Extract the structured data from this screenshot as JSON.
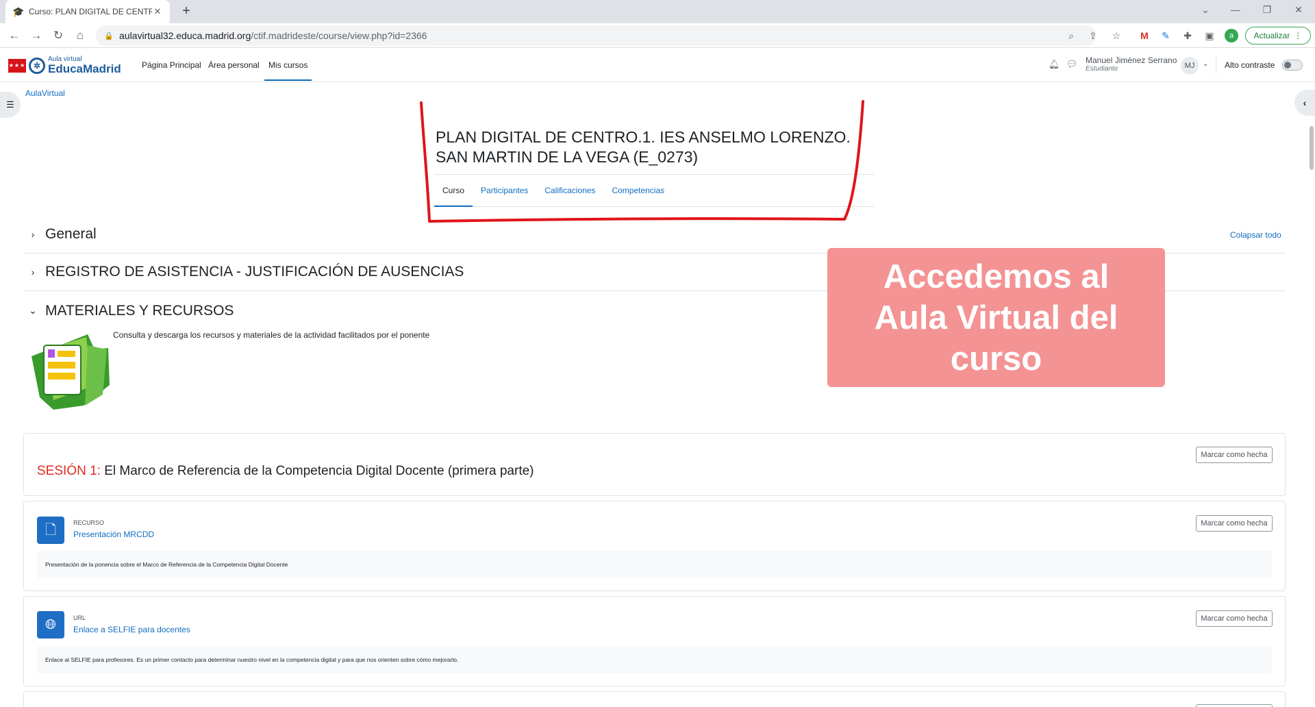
{
  "browser": {
    "tab_title": "Curso: PLAN DIGITAL DE CENTR",
    "new_tab": "+",
    "url_host": "aulavirtual32.educa.madrid.org",
    "url_path": "/ctif.madrideste/course/view.php?id=2366",
    "profile_initial": "a",
    "update_label": "Actualizar"
  },
  "site": {
    "logo_small": "Aula virtual",
    "logo_big": "EducaMadrid",
    "nav": [
      "Página Principal",
      "Área personal",
      "Mis cursos"
    ],
    "user_name": "Manuel Jiménez Serrano",
    "user_role": "Estudiante",
    "avatar_initials": "MJ",
    "contrast_label": "Alto contraste"
  },
  "breadcrumb": "AulaVirtual",
  "course": {
    "title_line1": "PLAN DIGITAL DE CENTRO.1. IES ANSELMO LORENZO.",
    "title_line2": "SAN MARTIN DE LA VEGA (E_0273)",
    "tabs": [
      "Curso",
      "Participantes",
      "Calificaciones",
      "Competencias"
    ]
  },
  "sections": {
    "collapse_all": "Colapsar todo",
    "general": "General",
    "registro": "REGISTRO DE ASISTENCIA - JUSTIFICACIÓN DE AUSENCIAS",
    "materiales": "MATERIALES Y RECURSOS",
    "materiales_desc": "Consulta y descarga los recursos y materiales de la actividad facilitados por el ponente"
  },
  "overlay": {
    "line1": "Accedemos al",
    "line2": "Aula Virtual del",
    "line3": "curso"
  },
  "session1": {
    "prefix": "SESIÓN 1:",
    "title": "El Marco de Referencia de la Competencia Digital Docente (primera parte)",
    "mark_label": "Marcar como hecha"
  },
  "activities": [
    {
      "type": "RECURSO",
      "name": "Presentación MRCDD",
      "desc": "Presentación de la ponencia sobre el Marco de Referencia de la Competencia Digital Docente",
      "mark_label": "Marcar como hecha"
    },
    {
      "type": "URL",
      "name": "Enlace a SELFIE para docentes",
      "desc": "Enlace al SELFIE para profesores. Es un primer contacto para determinar nuestro nivel en la competencia digital y para que nos orienten sobre cómo mejorarlo.",
      "mark_label": "Marcar como hecha"
    }
  ],
  "colors": {
    "link": "#0f6cbf",
    "session_prefix": "#e02b20",
    "overlay_bg": "#f49394",
    "annotation_red": "#e0151b",
    "activity_icon": "#1f6ec5"
  },
  "icons": [
    "back-icon",
    "forward-icon",
    "reload-icon",
    "home-icon",
    "lock-icon",
    "zoom-icon",
    "share-icon",
    "star-icon",
    "extension-icon",
    "sidepanel-icon",
    "bell-icon",
    "chat-icon",
    "file-icon",
    "globe-icon",
    "folder-icon"
  ]
}
